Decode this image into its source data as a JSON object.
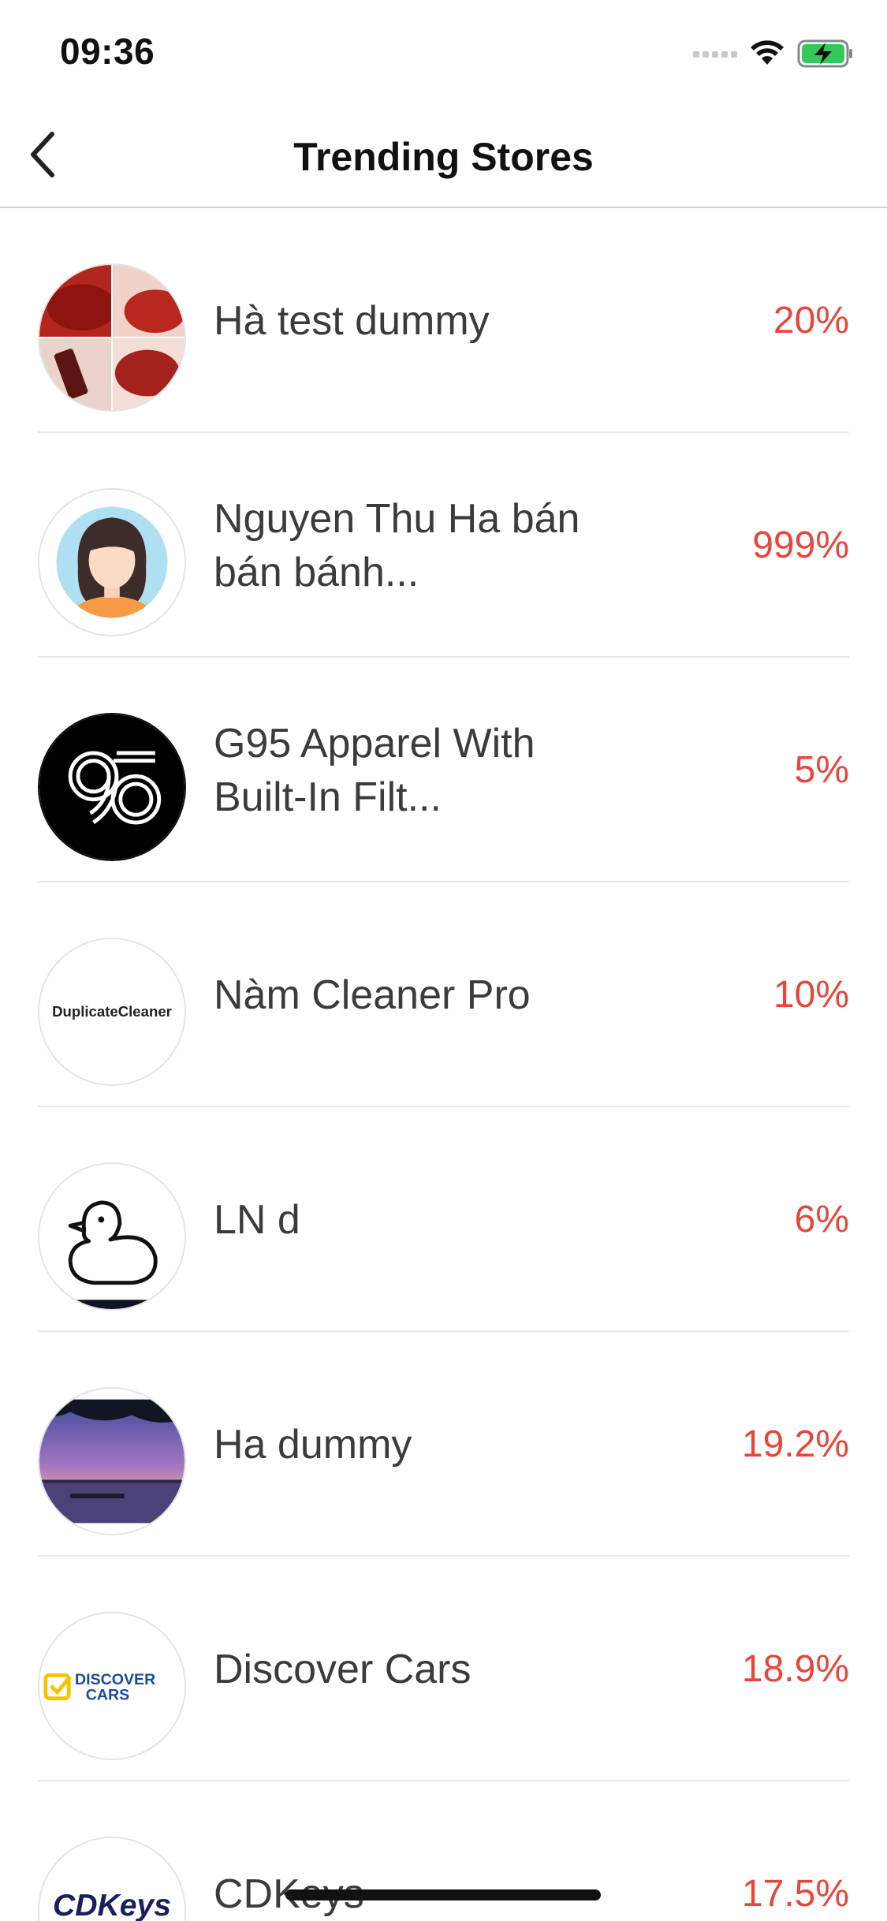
{
  "status_bar": {
    "time": "09:36",
    "icons": [
      "signal-icon",
      "wifi-icon",
      "battery-charging-icon"
    ]
  },
  "nav": {
    "title": "Trending Stores",
    "back_icon": "chevron-left-icon"
  },
  "accent_color": "#e8453c",
  "stores": [
    {
      "name": "Hà test dummy",
      "percent": "20%",
      "avatar": "lipstick-collage"
    },
    {
      "name": "Nguyen Thu Ha bán bán bánh...",
      "percent": "999%",
      "avatar": "woman-avatar"
    },
    {
      "name": "G95 Apparel With Built-In Filt...",
      "percent": "5%",
      "avatar": "g95-logo"
    },
    {
      "name": "Nàm Cleaner Pro",
      "percent": "10%",
      "avatar": "duplicate-cleaner-logo",
      "logo_text": "DuplicateCleaner"
    },
    {
      "name": "LN d",
      "percent": "6%",
      "avatar": "duck-outline"
    },
    {
      "name": "Ha dummy",
      "percent": "19.2%",
      "avatar": "lake-sunset-photo"
    },
    {
      "name": "Discover Cars",
      "percent": "18.9%",
      "avatar": "discover-cars-logo",
      "logo_text_1": "DISCOVER",
      "logo_text_2": "CARS"
    },
    {
      "name": "CDKeys",
      "percent": "17.5%",
      "avatar": "cdkeys-logo",
      "logo_text": "CDKeys"
    }
  ]
}
